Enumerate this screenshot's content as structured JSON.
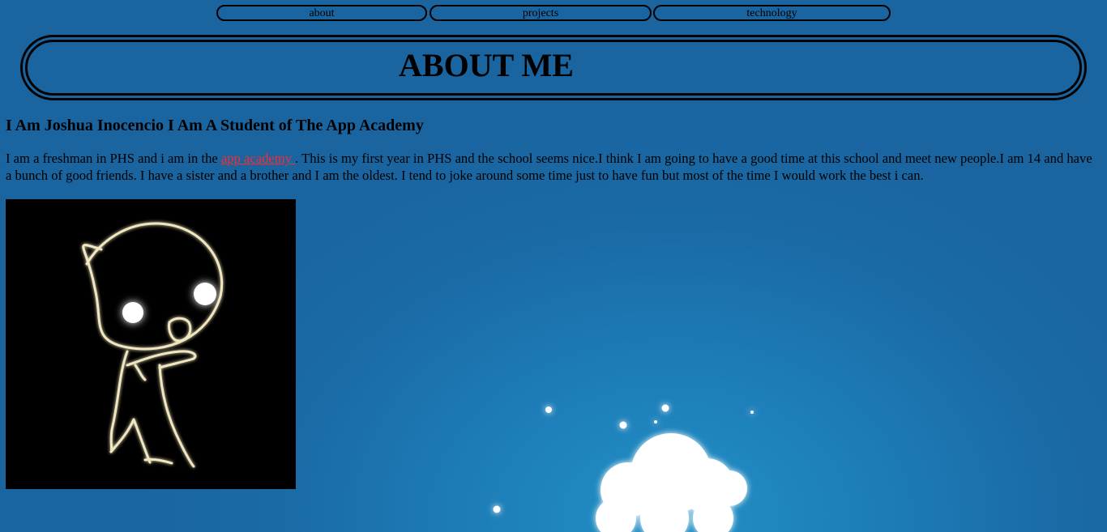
{
  "nav": {
    "about": "about",
    "projects": "projects",
    "technology": "technology"
  },
  "header": {
    "title": "ABOUT ME"
  },
  "subtitle": "I Am Joshua Inocencio I Am A Student of The App Academy",
  "bio": {
    "before_link": "I am a freshman in PHS and i am in the ",
    "link_text": "app academy ",
    "after_link": ". This is my first year in PHS and the school seems nice.I think I am going to have a good time at this school and meet new people.I am 14 and have a bunch of good friends. I have a sister and a brother and I am the oldest. I tend to joke around some time just to have fun but most of the time I would work the best i can."
  },
  "colors": {
    "background": "#1a6aa5",
    "link": "#ff2a2a",
    "avatar_bg": "#000000",
    "avatar_line": "#f0e6c0"
  },
  "icons": {
    "avatar": "chibi-character-drawing",
    "background": "glowing-cloud-and-stars"
  }
}
